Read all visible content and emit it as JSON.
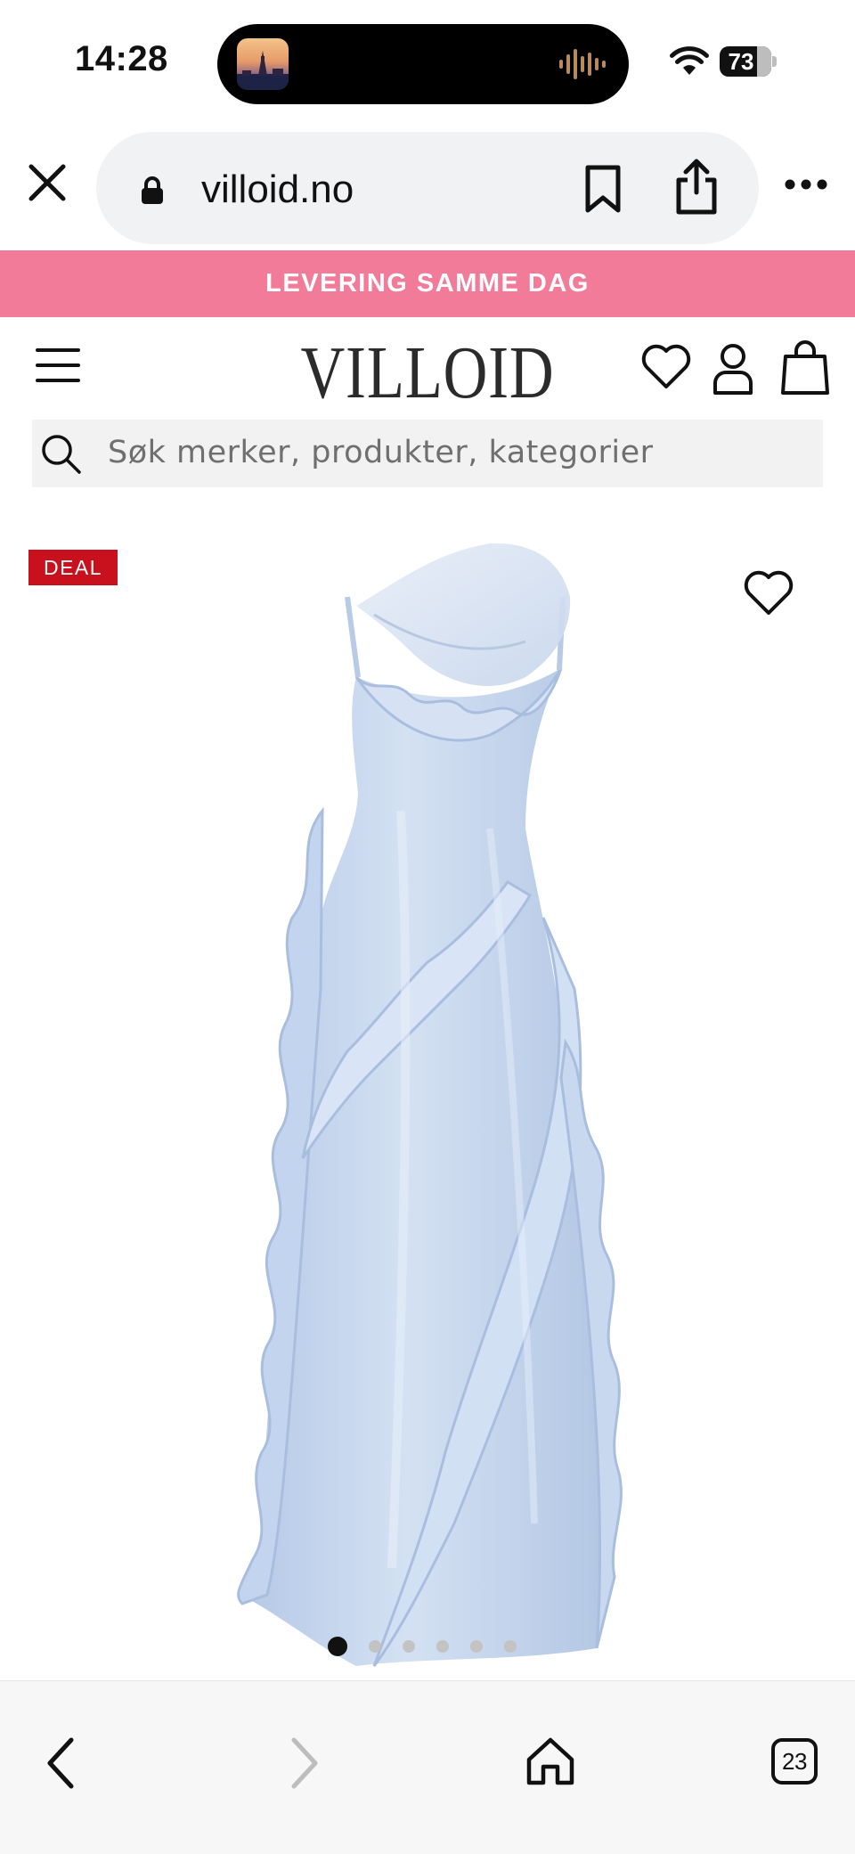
{
  "status_bar": {
    "time": "14:28",
    "battery_percent": "73",
    "battery_level": 0.73,
    "icons": [
      "now-playing-thumbnail-icon",
      "audio-waveform-icon",
      "wifi-icon",
      "battery-icon"
    ]
  },
  "browser": {
    "url": "villoid.no",
    "tab_count": "23",
    "icons": [
      "close-icon",
      "lock-icon",
      "bookmark-icon",
      "share-icon",
      "more-icon",
      "back-icon",
      "forward-icon",
      "home-icon",
      "tabs-icon"
    ]
  },
  "promo": {
    "text": "LEVERING SAMME DAG",
    "background": "#f37b9a"
  },
  "header": {
    "logo": "VILLOID",
    "icons": [
      "menu-icon",
      "heart-icon",
      "account-icon",
      "shopping-bag-icon"
    ]
  },
  "search": {
    "placeholder": "Søk merker, produkter, kategorier"
  },
  "product": {
    "badge": "DEAL",
    "badge_color": "#c9111d",
    "image_subject": "light blue ruffled satin maxi dress with sheer scarf",
    "dress_color": "#c6d7ee",
    "carousel": {
      "total": 6,
      "active_index": 0
    }
  }
}
